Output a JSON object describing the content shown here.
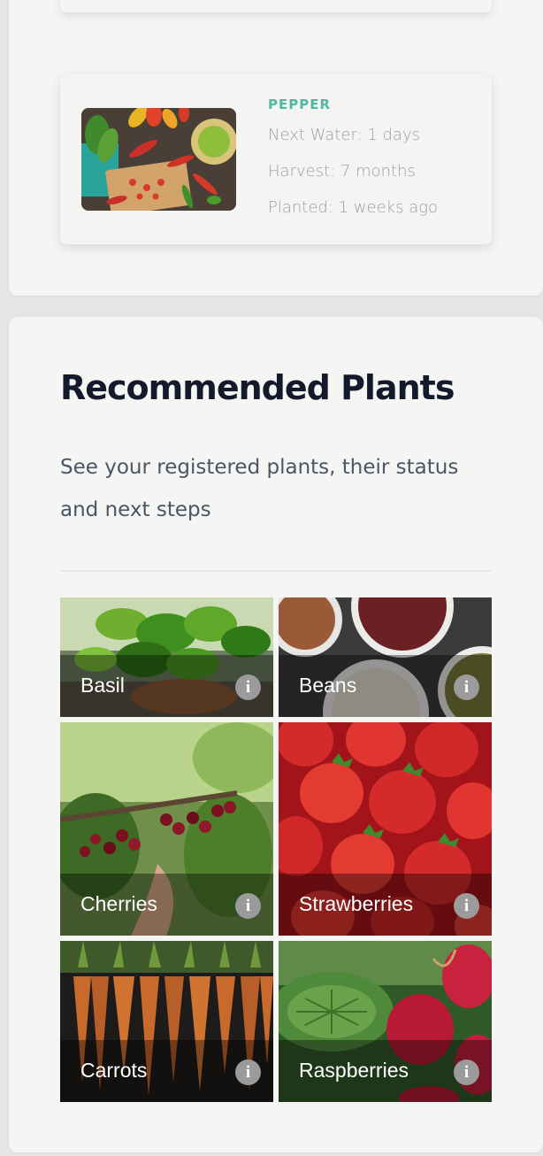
{
  "current_plant": {
    "name": "PEPPER",
    "next_water": "Next Water: 1 days",
    "harvest": "Harvest: 7 months",
    "planted": "Planted: 1 weeks ago"
  },
  "recommended": {
    "title": "Recommended Plants",
    "subtitle": "See your registered plants, their status and next steps",
    "info_icon_glyph": "i",
    "plants": [
      {
        "label": "Basil",
        "icon": "info-icon"
      },
      {
        "label": "Beans",
        "icon": "info-icon"
      },
      {
        "label": "Cherries",
        "icon": "info-icon"
      },
      {
        "label": "Strawberries",
        "icon": "info-icon"
      },
      {
        "label": "Carrots",
        "icon": "info-icon"
      },
      {
        "label": "Raspberries",
        "icon": "info-icon"
      }
    ]
  },
  "colors": {
    "accent": "#4fb8a0",
    "title": "#131a2b",
    "subtitle": "#4a5565",
    "muted_text": "#9aa0a6",
    "page_bg": "#e3e6e3",
    "panel_bg": "#f5f5f3"
  }
}
